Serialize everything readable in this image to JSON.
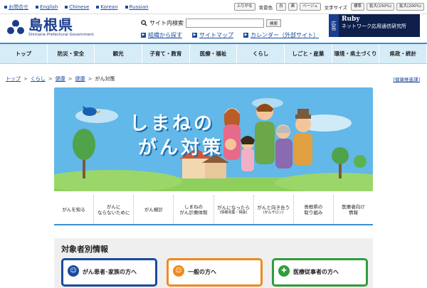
{
  "topbar": {
    "links": [
      "お問合せ",
      "English",
      "Chinese",
      "Korean",
      "Russian"
    ],
    "furigana": "ふりがな",
    "bg_label": "背景色",
    "bg_options": [
      "白",
      "黒",
      "ベージュ"
    ],
    "font_label": "文字サイズ",
    "font_options": [
      "標準",
      "拡大(150%)",
      "拡大(200%)"
    ]
  },
  "header": {
    "logo_name": "島根県",
    "logo_sub": "Shimane Prefectural Government",
    "search_label": "サイト内検索",
    "search_value": "",
    "search_button": "検索",
    "links": [
      "組織から探す",
      "サイトマップ",
      "カレンダー（外部サイト）"
    ]
  },
  "ad": {
    "tag": "広告",
    "line1": "Ruby",
    "line2": "ネットワーク応用通信研究所"
  },
  "nav": [
    "トップ",
    "防災・安全",
    "観光",
    "子育て・教育",
    "医療・福祉",
    "くらし",
    "しごと・産業",
    "環境・県土づくり",
    "県政・統計"
  ],
  "breadcrumb": [
    "トップ",
    "くらし",
    "健康",
    "健康",
    "がん対策"
  ],
  "kenko_link": "[健康推進課]",
  "banner": {
    "title_line1": "しまねの",
    "title_line2": "がん対策"
  },
  "tabs": [
    {
      "label": "がんを知る",
      "sub": ""
    },
    {
      "label": "がんに\nならないために",
      "sub": ""
    },
    {
      "label": "がん検診",
      "sub": ""
    },
    {
      "label": "しまねの\nがん診療体制",
      "sub": ""
    },
    {
      "label": "がんになったら",
      "sub": "(情報収集・相談)"
    },
    {
      "label": "がんと向き合う",
      "sub": "(がんサロン)"
    },
    {
      "label": "島根県の\n取り組み",
      "sub": ""
    },
    {
      "label": "医療者向け\n情報",
      "sub": ""
    }
  ],
  "section": {
    "title": "対象者別情報",
    "cards": [
      {
        "label": "がん患者･家族の方へ",
        "color": "#1a4a9e"
      },
      {
        "label": "一般の方へ",
        "color": "#f08a1c"
      },
      {
        "label": "医療従事者の方へ",
        "color": "#2e9d3a"
      }
    ]
  },
  "colors": {
    "brand": "#1a3d8f",
    "nav_bg": "#d6ecf7",
    "nav_border": "#3a8fd0",
    "banner_bg": "#62b8e8"
  }
}
